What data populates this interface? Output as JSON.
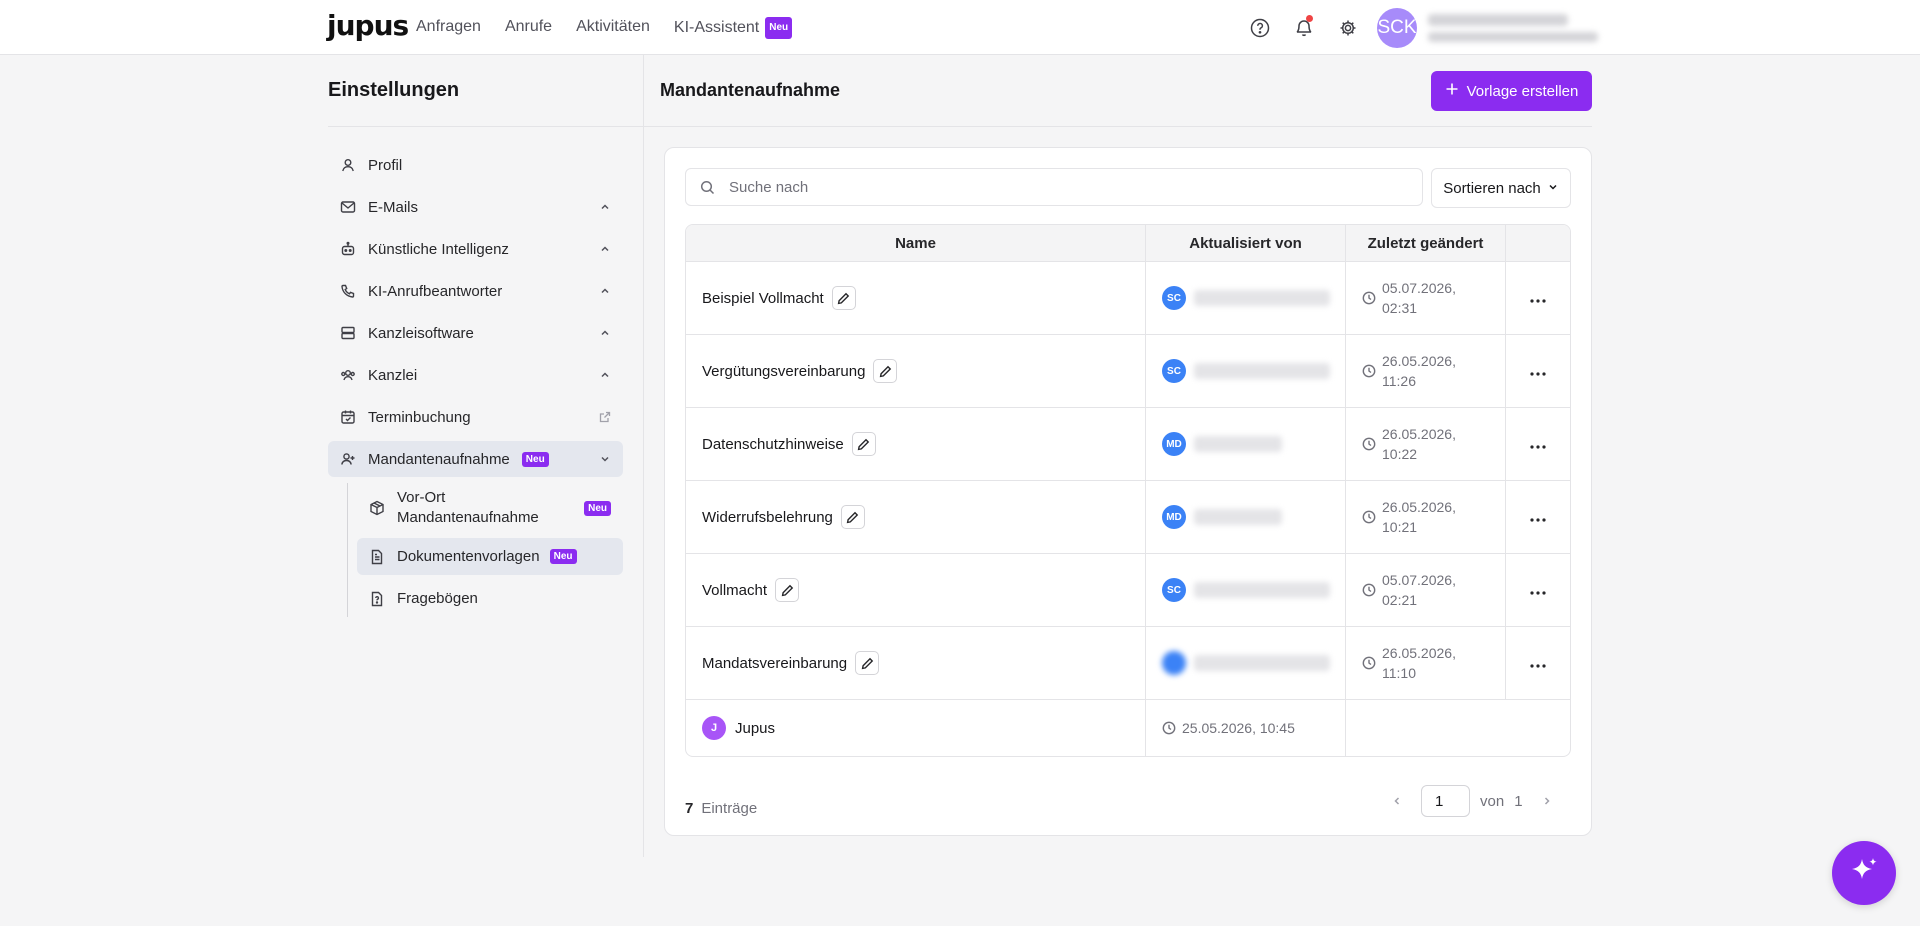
{
  "app": {
    "logo": "jupus"
  },
  "nav": {
    "items": [
      "Anfragen",
      "Anrufe",
      "Aktivitäten"
    ],
    "ki_assistant": "KI-Assistent",
    "ki_badge": "Neu"
  },
  "topbar": {
    "icons": [
      "help-icon",
      "bell-icon",
      "gear-icon"
    ],
    "avatar_initials": "SCK"
  },
  "sidebar": {
    "title": "Einstellungen",
    "items": [
      {
        "label": "Profil",
        "icon": "user-icon"
      },
      {
        "label": "E-Mails",
        "icon": "mail-icon",
        "expandable": true
      },
      {
        "label": "Künstliche Intelligenz",
        "icon": "robot-icon",
        "expandable": true
      },
      {
        "label": "KI-Anrufbeantworter",
        "icon": "phone-icon",
        "expandable": true
      },
      {
        "label": "Kanzleisoftware",
        "icon": "server-icon",
        "expandable": true
      },
      {
        "label": "Kanzlei",
        "icon": "team-icon",
        "expandable": true
      },
      {
        "label": "Terminbuchung",
        "icon": "calendar-icon",
        "external": true
      },
      {
        "label": "Mandantenaufnahme",
        "icon": "user-plus-icon",
        "badge": "Neu",
        "active": true
      }
    ],
    "subitems": [
      {
        "label": "Vor-Ort Mandantenaufnahme",
        "icon": "box-icon",
        "badge": "Neu"
      },
      {
        "label": "Dokumentenvorlagen",
        "icon": "document-icon",
        "badge": "Neu",
        "active": true
      },
      {
        "label": "Fragebögen",
        "icon": "questionnaire-icon"
      }
    ]
  },
  "main": {
    "title": "Mandantenaufnahme",
    "create_button": "Vorlage erstellen",
    "search_placeholder": "Suche nach",
    "sort_label": "Sortieren nach"
  },
  "table": {
    "headers": [
      "Name",
      "Aktualisiert von",
      "Zuletzt geändert"
    ],
    "rows": [
      {
        "name": "Beispiel Vollmacht",
        "user_initials": "SC",
        "date": "05.07.2026, 02:31"
      },
      {
        "name": "Vergütungsvereinbarung",
        "user_initials": "SC",
        "date": "26.05.2026, 11:26"
      },
      {
        "name": "Datenschutzhinweise",
        "user_initials": "MD",
        "date": "26.05.2026, 10:22"
      },
      {
        "name": "Widerrufsbelehrung",
        "user_initials": "MD",
        "date": "26.05.2026, 10:21"
      },
      {
        "name": "Vollmacht",
        "user_initials": "SC",
        "date": "05.07.2026, 02:21"
      },
      {
        "name": "Mandatsvereinbarung",
        "user_initials": "",
        "date": "26.05.2026, 11:10"
      }
    ],
    "footer_row": {
      "avatar": "J",
      "name": "Jupus",
      "date": "25.05.2026, 10:45"
    }
  },
  "pagination": {
    "count": "7",
    "count_label": "Einträge",
    "page": "1",
    "of_label": "von",
    "total_pages": "1"
  },
  "colors": {
    "accent": "#8b2cf0",
    "avatar_blue": "#3b82f6",
    "notification": "#ef4444"
  }
}
